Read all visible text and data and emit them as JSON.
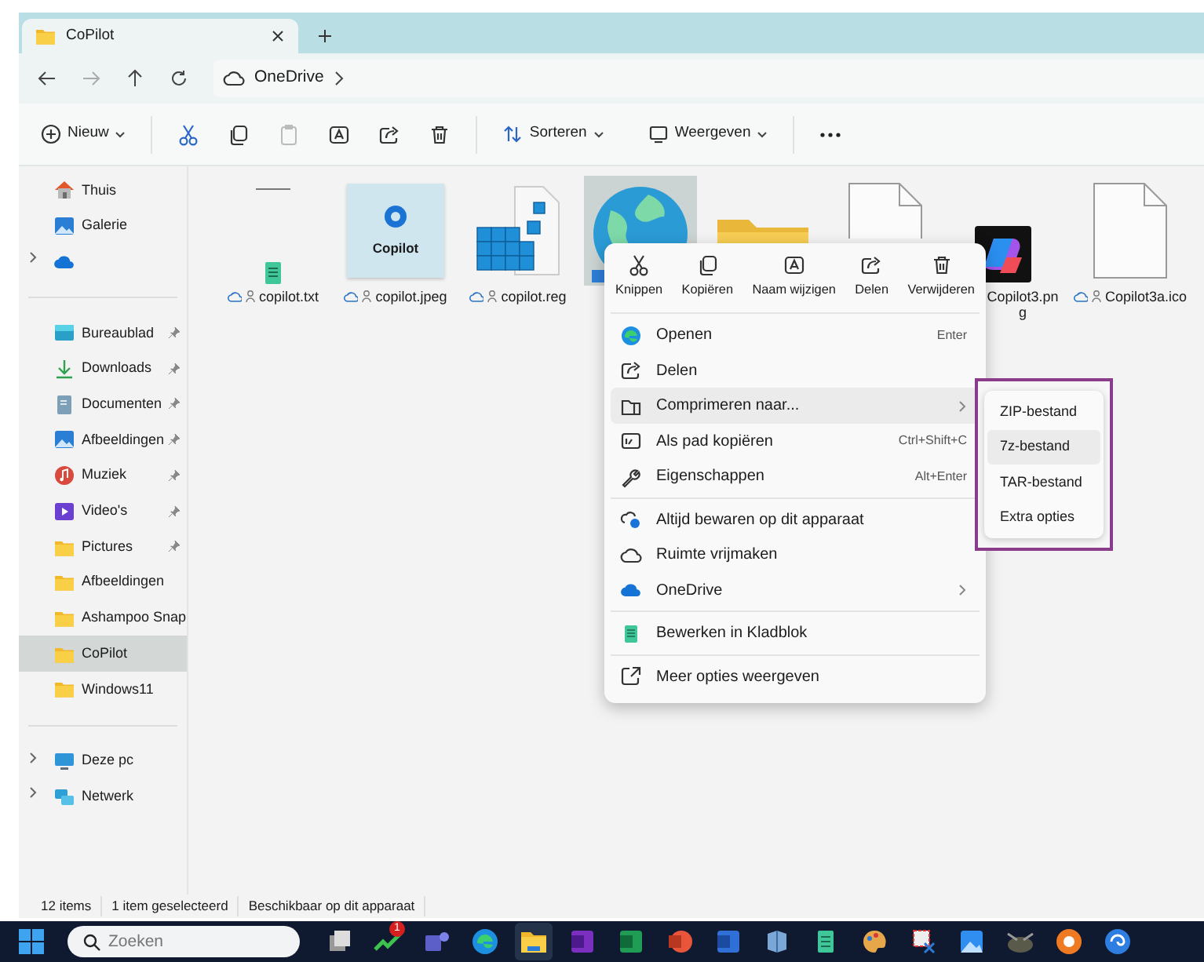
{
  "window": {
    "tab_title": "CoPilot"
  },
  "address": {
    "location": "OneDrive"
  },
  "toolbar": {
    "new": "Nieuw",
    "sort": "Sorteren",
    "view": "Weergeven"
  },
  "sidebar": {
    "top": [
      {
        "label": "Thuis",
        "kind": "home"
      },
      {
        "label": "Galerie",
        "kind": "gallery"
      },
      {
        "kind": "onedrive",
        "expander": true
      }
    ],
    "folders": [
      {
        "label": "Bureaublad",
        "kind": "desktop",
        "pinned": true,
        "selected": false
      },
      {
        "label": "Downloads",
        "kind": "download",
        "pinned": true,
        "selected": false
      },
      {
        "label": "Documenten",
        "kind": "document",
        "pinned": true,
        "selected": false
      },
      {
        "label": "Afbeeldingen",
        "kind": "images",
        "pinned": true,
        "selected": false
      },
      {
        "label": "Muziek",
        "kind": "music",
        "pinned": true,
        "selected": false
      },
      {
        "label": "Video's",
        "kind": "video",
        "pinned": true,
        "selected": false
      },
      {
        "label": "Pictures",
        "kind": "folder",
        "pinned": true,
        "selected": false
      },
      {
        "label": "Afbeeldingen",
        "kind": "folder",
        "pinned": false,
        "selected": false
      },
      {
        "label": "Ashampoo Snap",
        "kind": "folder",
        "pinned": false,
        "selected": false
      },
      {
        "label": "CoPilot",
        "kind": "folder",
        "pinned": false,
        "selected": true
      },
      {
        "label": "Windows11",
        "kind": "folder",
        "pinned": false,
        "selected": false
      }
    ],
    "devices": [
      {
        "label": "Deze pc",
        "kind": "pc",
        "expander": true
      },
      {
        "label": "Netwerk",
        "kind": "network",
        "expander": true
      }
    ]
  },
  "files": [
    {
      "name": "copilot.txt",
      "kind": "txt",
      "cloud": true,
      "selected": false
    },
    {
      "name": "copilot.jpeg",
      "kind": "jpeg",
      "thumb_text": "Copilot",
      "cloud": true,
      "selected": false
    },
    {
      "name": "copilot.reg",
      "kind": "reg",
      "cloud": true,
      "selected": false
    },
    {
      "kind": "globe",
      "cloud": false,
      "selected": true
    },
    {
      "kind": "zip",
      "cloud": false,
      "selected": false
    },
    {
      "kind": "blank",
      "cloud": false,
      "selected": false
    },
    {
      "name": "Copilot3.png",
      "kind": "png",
      "cloud": false,
      "selected": false
    },
    {
      "name": "Copilot3a.ico",
      "kind": "blank",
      "cloud": true,
      "selected": false
    }
  ],
  "context_menu": {
    "actions": [
      {
        "label": "Knippen",
        "kind": "cut"
      },
      {
        "label": "Kopiëren",
        "kind": "copy"
      },
      {
        "label": "Naam wijzigen",
        "kind": "rename"
      },
      {
        "label": "Delen",
        "kind": "share"
      },
      {
        "label": "Verwijderen",
        "kind": "delete"
      }
    ],
    "sections": [
      [
        {
          "label": "Openen",
          "kind": "edge",
          "shortcut": "Enter",
          "submenu": false,
          "selected": false
        },
        {
          "label": "Delen",
          "kind": "share",
          "submenu": false,
          "selected": false
        },
        {
          "label": "Comprimeren naar...",
          "kind": "archive",
          "submenu": true,
          "selected": true
        },
        {
          "label": "Als pad kopiëren",
          "kind": "path",
          "shortcut": "Ctrl+Shift+C",
          "submenu": false,
          "selected": false
        },
        {
          "label": "Eigenschappen",
          "kind": "wrench",
          "shortcut": "Alt+Enter",
          "submenu": false,
          "selected": false
        }
      ],
      [
        {
          "label": "Altijd bewaren op dit apparaat",
          "kind": "keep",
          "submenu": false,
          "selected": false
        },
        {
          "label": "Ruimte vrijmaken",
          "kind": "cloud",
          "submenu": false,
          "selected": false
        },
        {
          "label": "OneDrive",
          "kind": "onedrive",
          "submenu": true,
          "selected": false
        }
      ],
      [
        {
          "label": "Bewerken in Kladblok",
          "kind": "notepad",
          "submenu": false,
          "selected": false
        }
      ],
      [
        {
          "label": "Meer opties weergeven",
          "kind": "more",
          "submenu": false,
          "selected": false
        }
      ]
    ]
  },
  "submenu": {
    "items": [
      {
        "label": "ZIP-bestand",
        "selected": false
      },
      {
        "label": "7z-bestand",
        "selected": true
      },
      {
        "label": "TAR-bestand",
        "selected": false
      },
      {
        "label": "Extra opties",
        "selected": false
      }
    ]
  },
  "status_bar": [
    "12 items",
    "1 item geselecteerd",
    "Beschikbaar op dit apparaat"
  ],
  "taskbar": {
    "search_placeholder": "Zoeken",
    "apps": [
      {
        "kind": "taskview",
        "selected": false
      },
      {
        "kind": "stocks",
        "badge": "1",
        "selected": false
      },
      {
        "kind": "teams",
        "selected": false
      },
      {
        "kind": "edge",
        "selected": false
      },
      {
        "kind": "explorer",
        "selected": true
      },
      {
        "kind": "onenote",
        "selected": false
      },
      {
        "kind": "excel",
        "selected": false
      },
      {
        "kind": "powerpoint",
        "selected": false
      },
      {
        "kind": "word",
        "selected": false
      },
      {
        "kind": "tool",
        "selected": false
      },
      {
        "kind": "notepad",
        "selected": false
      },
      {
        "kind": "paint",
        "selected": false
      },
      {
        "kind": "snip",
        "selected": false
      },
      {
        "kind": "photos",
        "selected": false
      },
      {
        "kind": "gimp",
        "selected": false
      },
      {
        "kind": "orange",
        "selected": false
      },
      {
        "kind": "swirl",
        "selected": false
      }
    ]
  }
}
